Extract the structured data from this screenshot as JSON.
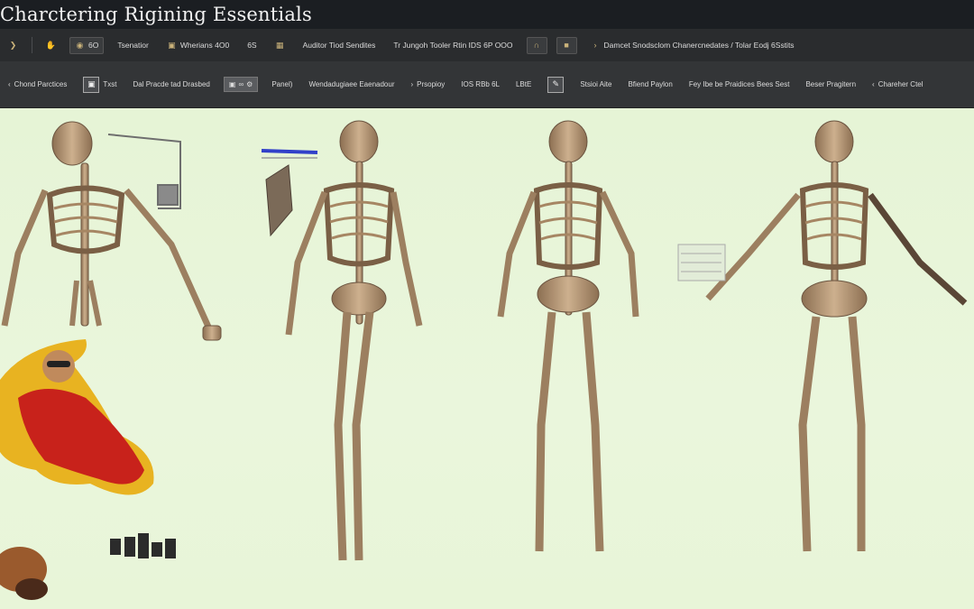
{
  "window": {
    "title": "Charctering Rigining Essentials"
  },
  "toolbar_top": {
    "items": [
      {
        "icon": "arrow-icon",
        "label": ""
      },
      {
        "icon": "hand-icon",
        "label": ""
      },
      {
        "icon": "camera-icon",
        "label": "6O"
      },
      {
        "icon": "",
        "label": "Tsenatior"
      },
      {
        "icon": "cube-icon",
        "label": "Wherians 4O0"
      },
      {
        "icon": "",
        "label": "6S"
      },
      {
        "icon": "grid-icon",
        "label": ""
      },
      {
        "icon": "",
        "label": "Auditor Tiod Sendites"
      },
      {
        "icon": "",
        "label": "Tr Jungoh Tooler Rtin IDS 6P OOO"
      },
      {
        "icon": "magnet-icon",
        "label": ""
      },
      {
        "icon": "square-icon",
        "label": ""
      },
      {
        "icon": "",
        "label": "Damcet Snodsclom Chanercnedates / Tolar Eodj 6Sstits"
      }
    ]
  },
  "toolbar_second": {
    "items": [
      {
        "label": "Chond Parctices"
      },
      {
        "label": "Txst"
      },
      {
        "label": "Dal Pracde tad Drasbed"
      },
      {
        "label": "Panel)"
      },
      {
        "label": "Wendadugiaee Eaenadour"
      },
      {
        "label": "Prsopioy"
      },
      {
        "label": "IOS RBb 6L"
      },
      {
        "label": "LBtE"
      },
      {
        "label": "Stsioi Aite"
      },
      {
        "label": "Bfiend Paylon"
      },
      {
        "label": "Fey Ibe be Praidices Bees Sest"
      },
      {
        "label": "Beser Pragitern"
      },
      {
        "label": "Chareher Ctel"
      }
    ]
  },
  "colors": {
    "viewport_bg": "#e8f5d8",
    "bone": "#b89a78",
    "bone_dark": "#6b5440",
    "titlebar_bg": "#1b1e22",
    "toolbar_bg": "#2a2c2e"
  }
}
